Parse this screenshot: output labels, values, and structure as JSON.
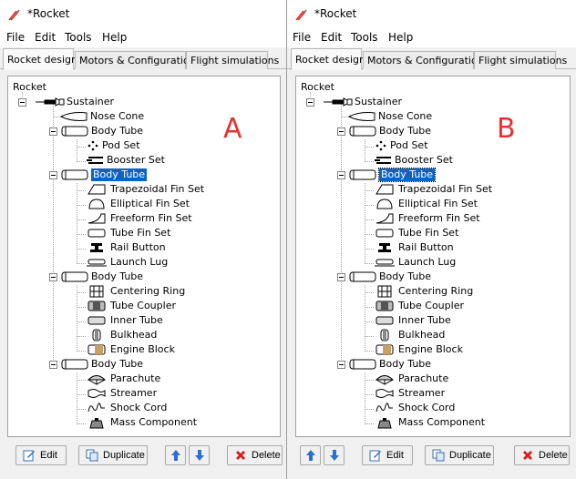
{
  "panels": [
    {
      "id": "a",
      "window_title": "*Rocket",
      "menu": [
        "File",
        "Edit",
        "Tools",
        "Help"
      ],
      "tabs": [
        "Rocket design",
        "Motors & Configuration",
        "Flight simulations"
      ],
      "tree_root": "Rocket",
      "stage": "Sustainer",
      "nose": "Nose Cone",
      "body_tube_1": {
        "label": "Body Tube",
        "children": [
          "Pod Set",
          "Booster Set"
        ]
      },
      "body_tube_2": {
        "label": "Body Tube",
        "children": [
          "Trapezoidal Fin Set",
          "Elliptical Fin Set",
          "Freeform Fin Set",
          "Tube Fin Set",
          "Rail Button",
          "Launch Lug"
        ]
      },
      "body_tube_3": {
        "label": "Body Tube",
        "children": [
          "Centering Ring",
          "Tube Coupler",
          "Inner Tube",
          "Bulkhead",
          "Engine Block"
        ]
      },
      "body_tube_4": {
        "label": "Body Tube",
        "children": [
          "Parachute",
          "Streamer",
          "Shock Cord",
          "Mass Component"
        ]
      },
      "marker": "A",
      "buttons": {
        "edit": "Edit",
        "duplicate": "Duplicate",
        "delete": "Delete"
      }
    },
    {
      "id": "b",
      "window_title": "*Rocket",
      "menu": [
        "File",
        "Edit",
        "Tools",
        "Help"
      ],
      "tabs": [
        "Rocket design",
        "Motors & Configuration",
        "Flight simulations"
      ],
      "tree_root": "Rocket",
      "stage": "Sustainer",
      "nose": "Nose Cone",
      "body_tube_1": {
        "label": "Body Tube",
        "children": [
          "Pod Set",
          "Booster Set"
        ]
      },
      "body_tube_2": {
        "label": "Body Tube",
        "children": [
          "Trapezoidal Fin Set",
          "Elliptical Fin Set",
          "Freeform Fin Set",
          "Tube Fin Set",
          "Rail Button",
          "Launch Lug"
        ]
      },
      "body_tube_3": {
        "label": "Body Tube",
        "children": [
          "Centering Ring",
          "Tube Coupler",
          "Inner Tube",
          "Bulkhead",
          "Engine Block"
        ]
      },
      "body_tube_4": {
        "label": "Body Tube",
        "children": [
          "Parachute",
          "Streamer",
          "Shock Cord",
          "Mass Component"
        ]
      },
      "marker": "B",
      "buttons": {
        "edit": "Edit",
        "duplicate": "Duplicate",
        "delete": "Delete"
      }
    }
  ],
  "colors": {
    "selection": "#0a64c8",
    "marker": "#e8312f",
    "delete_icon": "#d42020",
    "arrow_icon": "#2b6fd1"
  },
  "icons": [
    "rocket-app-icon",
    "stage-icon",
    "nose-cone-icon",
    "body-tube-icon",
    "pod-set-icon",
    "booster-set-icon",
    "trapezoidal-fin-icon",
    "elliptical-fin-icon",
    "freeform-fin-icon",
    "tube-fin-icon",
    "rail-button-icon",
    "launch-lug-icon",
    "centering-ring-icon",
    "tube-coupler-icon",
    "inner-tube-icon",
    "bulkhead-icon",
    "engine-block-icon",
    "parachute-icon",
    "streamer-icon",
    "shock-cord-icon",
    "mass-component-icon",
    "edit-icon",
    "duplicate-icon",
    "move-up-icon",
    "move-down-icon",
    "delete-icon"
  ]
}
